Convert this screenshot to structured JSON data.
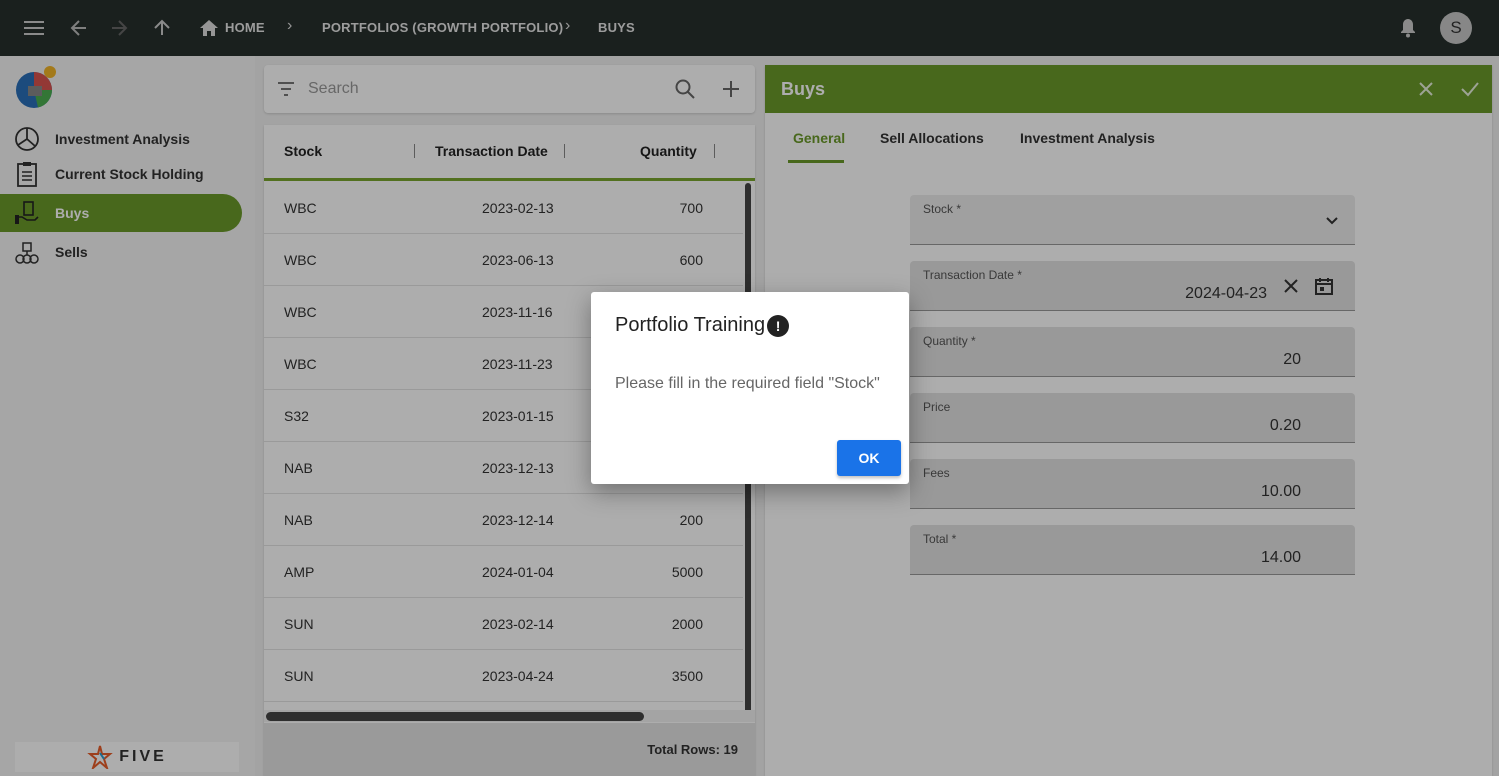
{
  "topbar": {
    "breadcrumbs": [
      "HOME",
      "PORTFOLIOS (GROWTH PORTFOLIO)",
      "BUYS"
    ],
    "avatar_initial": "S"
  },
  "sidebar": {
    "items": [
      {
        "label": "Investment Analysis",
        "icon": "pie-chart-icon",
        "active": false
      },
      {
        "label": "Current Stock Holding",
        "icon": "clipboard-icon",
        "active": false
      },
      {
        "label": "Buys",
        "icon": "hand-money-icon",
        "active": true
      },
      {
        "label": "Sells",
        "icon": "coins-icon",
        "active": false
      }
    ],
    "footer_logo_text": "FIVE"
  },
  "search": {
    "placeholder": "Search"
  },
  "table": {
    "columns": [
      "Stock",
      "Transaction Date",
      "Quantity"
    ],
    "rows": [
      [
        "WBC",
        "2023-02-13",
        "700"
      ],
      [
        "WBC",
        "2023-06-13",
        "600"
      ],
      [
        "WBC",
        "2023-11-16",
        ""
      ],
      [
        "WBC",
        "2023-11-23",
        ""
      ],
      [
        "S32",
        "2023-01-15",
        ""
      ],
      [
        "NAB",
        "2023-12-13",
        ""
      ],
      [
        "NAB",
        "2023-12-14",
        "200"
      ],
      [
        "AMP",
        "2024-01-04",
        "5000"
      ],
      [
        "SUN",
        "2023-02-14",
        "2000"
      ],
      [
        "SUN",
        "2023-04-24",
        "3500"
      ]
    ],
    "total_rows": "Total Rows: 19"
  },
  "panel": {
    "title": "Buys",
    "tabs": [
      "General",
      "Sell Allocations",
      "Investment Analysis"
    ],
    "fields": {
      "stock": {
        "label": "Stock *",
        "value": ""
      },
      "transaction_date": {
        "label": "Transaction Date *",
        "value": "2024-04-23"
      },
      "quantity": {
        "label": "Quantity *",
        "value": "20"
      },
      "price": {
        "label": "Price",
        "value": "0.20"
      },
      "fees": {
        "label": "Fees",
        "value": "10.00"
      },
      "total": {
        "label": "Total *",
        "value": "14.00"
      }
    }
  },
  "dialog": {
    "title": "Portfolio Training",
    "warning_symbol": "!",
    "message": "Please fill in the required field \"Stock\"",
    "ok_label": "OK"
  },
  "colors": {
    "accent_green": "#6b9a2a",
    "topbar_bg": "#27302d",
    "primary_blue": "#1a73e8"
  }
}
